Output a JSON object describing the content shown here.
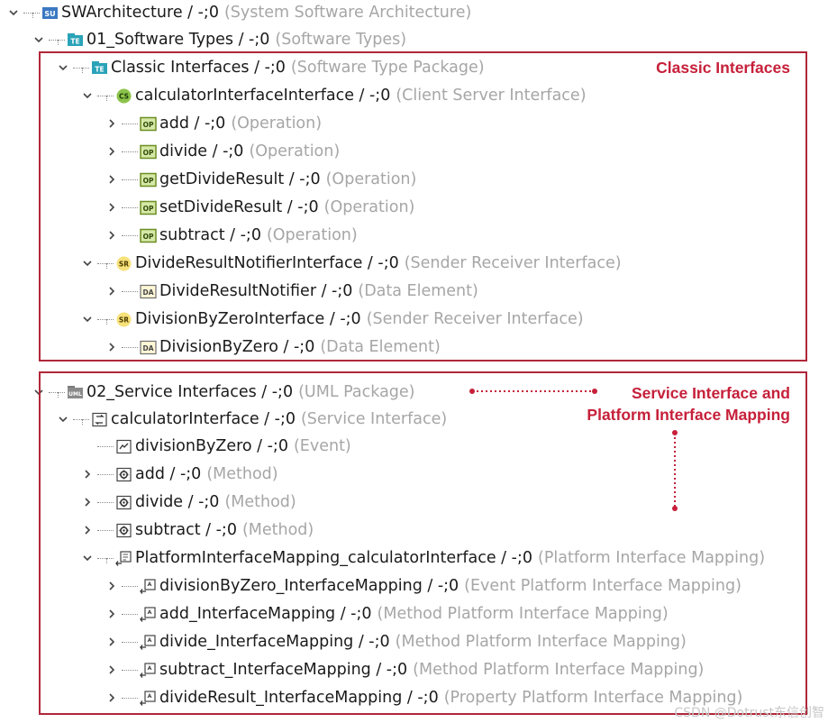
{
  "tree": {
    "rows": [
      {
        "name": "SWArchitecture / -;0",
        "type": "(System Software Architecture)",
        "icon": "system-architecture-icon",
        "expanded": true
      },
      {
        "name": "01_Software Types / -;0",
        "type": "(Software Types)",
        "icon": "software-type-package-icon",
        "expanded": true
      },
      {
        "name": "Classic Interfaces / -;0",
        "type": "(Software Type Package)",
        "icon": "software-type-package-icon",
        "expanded": true
      },
      {
        "name": "calculatorInterfaceInterface / -;0",
        "type": "(Client Server Interface)",
        "icon": "client-server-interface-icon",
        "expanded": true
      },
      {
        "name": "add / -;0",
        "type": "(Operation)",
        "icon": "operation-icon",
        "expanded": false
      },
      {
        "name": "divide / -;0",
        "type": "(Operation)",
        "icon": "operation-icon",
        "expanded": false
      },
      {
        "name": "getDivideResult / -;0",
        "type": "(Operation)",
        "icon": "operation-icon",
        "expanded": false
      },
      {
        "name": "setDivideResult / -;0",
        "type": "(Operation)",
        "icon": "operation-icon",
        "expanded": false
      },
      {
        "name": "subtract / -;0",
        "type": "(Operation)",
        "icon": "operation-icon",
        "expanded": false
      },
      {
        "name": "DivideResultNotifierInterface / -;0",
        "type": "(Sender Receiver Interface)",
        "icon": "sender-receiver-interface-icon",
        "expanded": true
      },
      {
        "name": "DivideResultNotifier / -;0",
        "type": "(Data Element)",
        "icon": "data-element-icon",
        "expanded": false
      },
      {
        "name": "DivisionByZeroInterface / -;0",
        "type": "(Sender Receiver Interface)",
        "icon": "sender-receiver-interface-icon",
        "expanded": true
      },
      {
        "name": "DivisionByZero / -;0",
        "type": "(Data Element)",
        "icon": "data-element-icon",
        "expanded": false
      },
      {
        "name": "02_Service Interfaces / -;0",
        "type": "(UML Package)",
        "icon": "uml-package-icon",
        "expanded": true
      },
      {
        "name": "calculatorInterface / -;0",
        "type": "(Service Interface)",
        "icon": "service-interface-icon",
        "expanded": true
      },
      {
        "name": "divisionByZero / -;0",
        "type": "(Event)",
        "icon": "event-icon",
        "expanded": null
      },
      {
        "name": "add / -;0",
        "type": "(Method)",
        "icon": "method-icon",
        "expanded": false
      },
      {
        "name": "divide / -;0",
        "type": "(Method)",
        "icon": "method-icon",
        "expanded": false
      },
      {
        "name": "subtract / -;0",
        "type": "(Method)",
        "icon": "method-icon",
        "expanded": false
      },
      {
        "name": "PlatformInterfaceMapping_calculatorInterface / -;0",
        "type": "(Platform Interface Mapping)",
        "icon": "platform-interface-mapping-icon",
        "expanded": true
      },
      {
        "name": "divisionByZero_InterfaceMapping / -;0",
        "type": "(Event Platform Interface Mapping)",
        "icon": "interface-mapping-icon",
        "expanded": false
      },
      {
        "name": "add_InterfaceMapping / -;0",
        "type": "(Method Platform Interface Mapping)",
        "icon": "interface-mapping-icon",
        "expanded": false
      },
      {
        "name": "divide_InterfaceMapping / -;0",
        "type": "(Method Platform Interface Mapping)",
        "icon": "interface-mapping-icon",
        "expanded": false
      },
      {
        "name": "subtract_InterfaceMapping / -;0",
        "type": "(Method Platform Interface Mapping)",
        "icon": "interface-mapping-icon",
        "expanded": false
      },
      {
        "name": "divideResult_InterfaceMapping / -;0",
        "type": "(Property Platform Interface Mapping)",
        "icon": "interface-mapping-icon",
        "expanded": false
      }
    ]
  },
  "annotations": {
    "classic_interfaces": "Classic Interfaces",
    "service_mapping_line1": "Service Interface and",
    "service_mapping_line2": "Platform Interface Mapping"
  },
  "icon_labels": {
    "system_architecture": "SU",
    "software_type_package": "TE",
    "client_server_interface": "CS",
    "sender_receiver_interface": "SR",
    "operation": "OP",
    "data_element": "DA",
    "uml_package": "UML"
  },
  "colors": {
    "accent_red": "#b0273a",
    "annotation_red": "#c6203a",
    "type_gray": "#a6a6a6",
    "package_teal": "#2aa3b8",
    "operation_green": "#6b8e23",
    "cs_green": "#8bc34a",
    "sr_yellow": "#f7e17a"
  },
  "watermark": "CSDN @Dotrust东信创智"
}
